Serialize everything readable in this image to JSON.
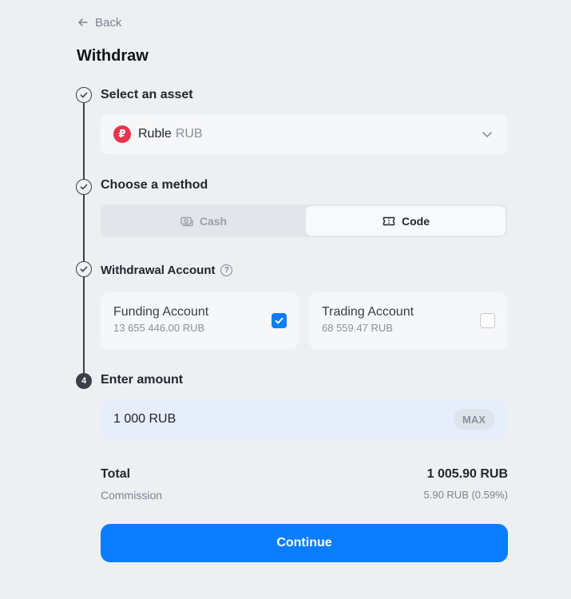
{
  "nav": {
    "back_label": "Back"
  },
  "page": {
    "title": "Withdraw"
  },
  "steps": [
    {
      "label": "Select an asset",
      "status": "done"
    },
    {
      "label": "Choose a method",
      "status": "done"
    },
    {
      "label": "Withdrawal Account",
      "status": "done"
    },
    {
      "label": "Enter amount",
      "status": "current",
      "number": "4"
    }
  ],
  "asset": {
    "name": "Ruble",
    "code": "RUB",
    "icon": "ruble-coin-icon",
    "icon_color": "#e8344e"
  },
  "method": {
    "options": [
      {
        "label": "Cash",
        "icon": "cash-icon",
        "selected": false
      },
      {
        "label": "Code",
        "icon": "code-ticket-icon",
        "selected": true
      }
    ]
  },
  "accounts": [
    {
      "name": "Funding Account",
      "balance": "13 655 446.00 RUB",
      "checked": true
    },
    {
      "name": "Trading Account",
      "balance": "68 559.47 RUB",
      "checked": false
    }
  ],
  "amount": {
    "value": "1 000 RUB",
    "max_label": "MAX"
  },
  "summary": {
    "total_label": "Total",
    "total_value": "1 005.90 RUB",
    "commission_label": "Commission",
    "commission_value": "5.90 RUB (0.59%)"
  },
  "actions": {
    "continue_label": "Continue"
  },
  "colors": {
    "accent": "#0a7dff",
    "background": "#edf0f3",
    "timeline": "#3b3f4a"
  }
}
